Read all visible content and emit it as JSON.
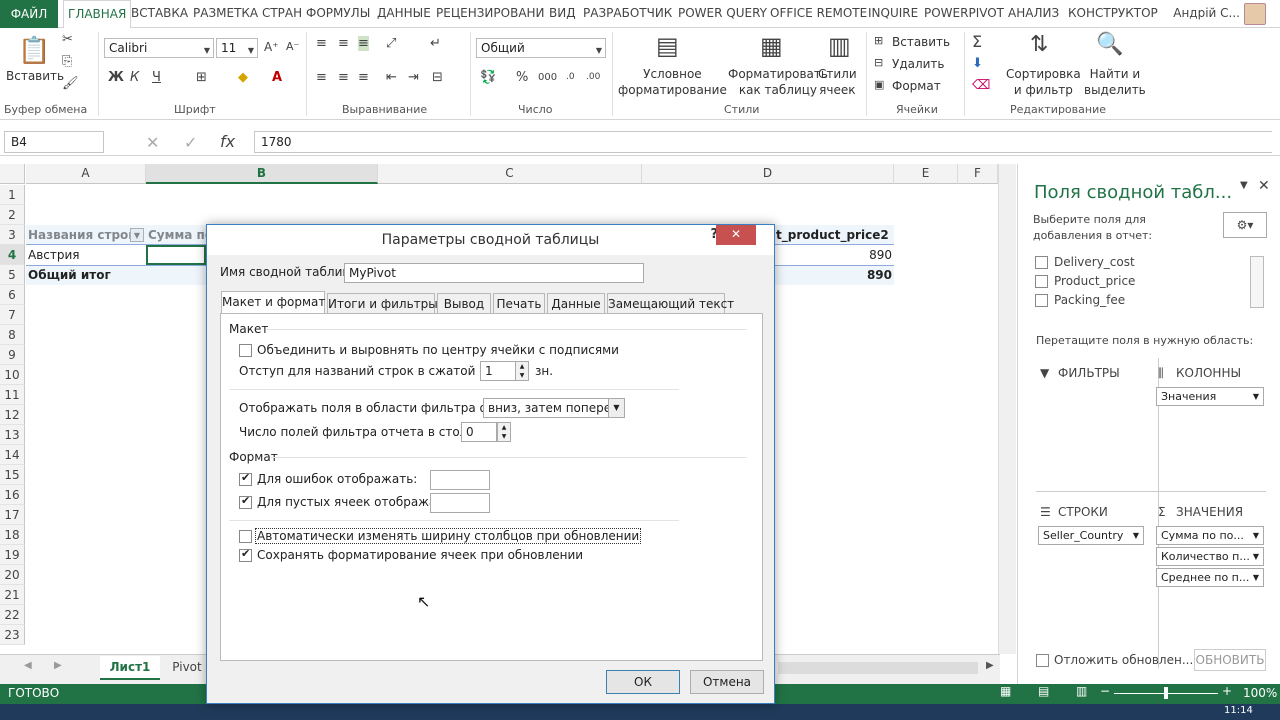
{
  "ribbon_tabs": [
    "ФАЙЛ",
    "ГЛАВНАЯ",
    "ВСТАВКА",
    "РАЗМЕТКА СТРАН",
    "ФОРМУЛЫ",
    "ДАННЫЕ",
    "РЕЦЕНЗИРОВАНИ",
    "ВИД",
    "РАЗРАБОТЧИК",
    "POWER QUERY",
    "OFFICE REMOTE",
    "INQUIRE",
    "POWERPIVOT",
    "АНАЛИЗ",
    "КОНСТРУКТОР"
  ],
  "user_name": "Андрій С...",
  "ribbon": {
    "paste": "Вставить",
    "clipboard_group": "Буфер обмена",
    "font_name": "Calibri",
    "font_size": "11",
    "bold": "Ж",
    "italic": "К",
    "underline": "Ч",
    "font_group": "Шрифт",
    "align_group": "Выравнивание",
    "number_format": "Общий",
    "number_group": "Число",
    "percent": "%",
    "thousands": "000",
    "cond_format": "Условное\nформатирование",
    "format_table": "Форматировать\nкак таблицу",
    "cell_styles": "Стили\nячеек",
    "styles_group": "Стили",
    "insert": "Вставить",
    "delete": "Удалить",
    "format": "Формат",
    "cells_group": "Ячейки",
    "sort": "Сортировка\nи фильтр",
    "find": "Найти и\nвыделить",
    "edit_group": "Редактирование"
  },
  "formula_bar": {
    "name_box": "B4",
    "fx": "fx",
    "value": "1780"
  },
  "columns": [
    "A",
    "B",
    "C",
    "D",
    "E",
    "F"
  ],
  "rows": [
    "1",
    "2",
    "3",
    "4",
    "5",
    "6",
    "7",
    "8",
    "9",
    "10",
    "11",
    "12",
    "13",
    "14",
    "15",
    "16",
    "17",
    "18",
    "19",
    "20",
    "21",
    "22",
    "23"
  ],
  "cells": {
    "a3": "Названия строк",
    "b3": "Сумма по",
    "d3": "t_product_price2",
    "a4": "Австрия",
    "d4": "890",
    "a5": "Общий итог",
    "d5": "890"
  },
  "pivot_pane": {
    "title": "Поля сводной табл...",
    "choose_label": "Выберите поля для добавления в отчет:",
    "fields": [
      "Delivery_cost",
      "Product_price",
      "Packing_fee"
    ],
    "drag_label": "Перетащите поля в нужную область:",
    "filters": "ФИЛЬТРЫ",
    "columns": "КОЛОННЫ",
    "rows": "СТРОКИ",
    "values": "ЗНАЧЕНИЯ",
    "columns_items": [
      "Значения"
    ],
    "rows_items": [
      "Seller_Country"
    ],
    "values_items": [
      "Сумма по по...",
      "Количество п...",
      "Среднее по п..."
    ],
    "defer_label": "Отложить обновлен...",
    "update_button": "ОБНОВИТЬ"
  },
  "sheet_tabs": [
    "Лист1",
    "Pivot"
  ],
  "status": {
    "ready": "ГОТОВО",
    "zoom": "100%"
  },
  "taskbar": {
    "time": "11:14"
  },
  "dialog": {
    "title": "Параметры сводной таблицы",
    "name_label": "Имя сводной таблицы:",
    "name_value": "MyPivot",
    "tabs": [
      "Макет и формат",
      "Итоги и фильтры",
      "Вывод",
      "Печать",
      "Данные",
      "Замещающий текст"
    ],
    "layout_section": "Макет",
    "merge_label": "Объединить и выровнять по центру ячейки с подписями",
    "merge_checked": false,
    "indent_label": "Отступ для названий строк в сжатой форме:",
    "indent_value": "1",
    "indent_unit": "зн.",
    "filter_order_label": "Отображать поля в области фильтра отчета:",
    "filter_order_value": "вниз, затем поперек",
    "filter_count_label": "Число полей фильтра отчета в столбце:",
    "filter_count_value": "0",
    "format_section": "Формат",
    "errors_label": "Для ошибок отображать:",
    "errors_checked": true,
    "empty_label": "Для пустых ячеек отображать:",
    "empty_checked": true,
    "autofit_label": "Автоматически изменять ширину столбцов при обновлении",
    "autofit_checked": false,
    "preserve_label": "Сохранять форматирование ячеек при обновлении",
    "preserve_checked": true,
    "ok": "ОК",
    "cancel": "Отмена"
  },
  "colors": {
    "excel_green": "#217346",
    "dialog_border": "#3a7fc1",
    "close_red": "#c75050"
  }
}
